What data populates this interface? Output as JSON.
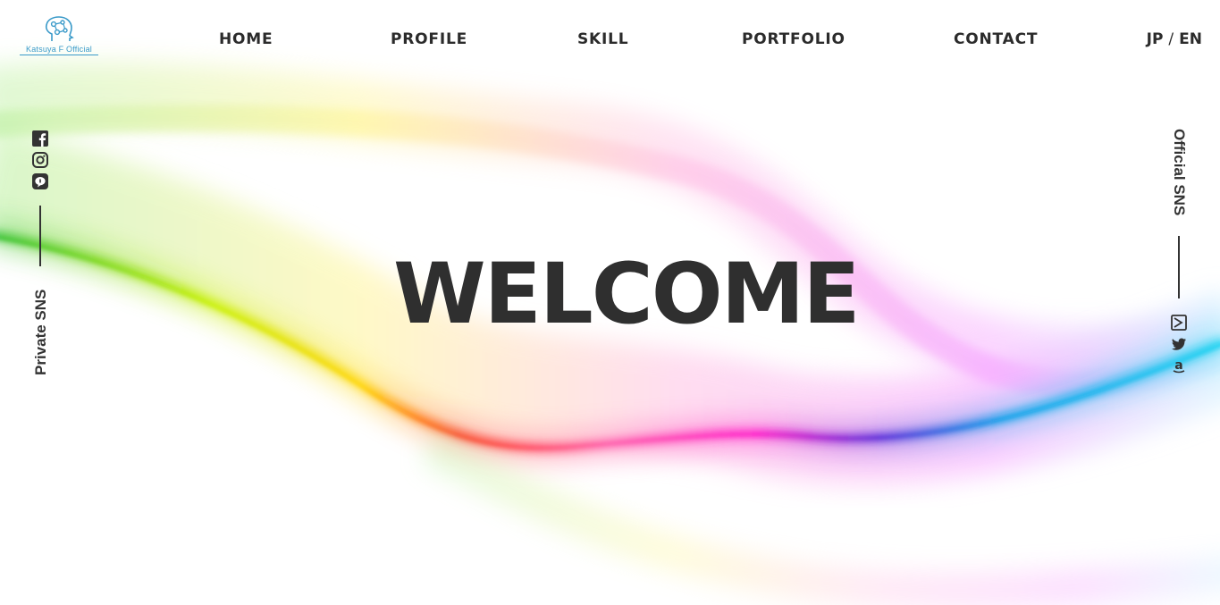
{
  "brand": {
    "logo_text": "Katsuya F Official",
    "accent_color": "#3a9ac9"
  },
  "nav": {
    "items": [
      {
        "label": "HOME"
      },
      {
        "label": "PROFILE"
      },
      {
        "label": "SKILL"
      },
      {
        "label": "PORTFOLIO"
      },
      {
        "label": "CONTACT"
      }
    ]
  },
  "language": {
    "jp": "JP",
    "separator": "/",
    "en": "EN"
  },
  "hero": {
    "title": "WELCOME"
  },
  "private_sns": {
    "label": "Private SNS",
    "icons": [
      "facebook-icon",
      "instagram-icon",
      "line-icon"
    ]
  },
  "official_sns": {
    "label": "Official SNS",
    "icons": [
      "mail-icon",
      "twitter-icon",
      "amazon-icon"
    ]
  }
}
